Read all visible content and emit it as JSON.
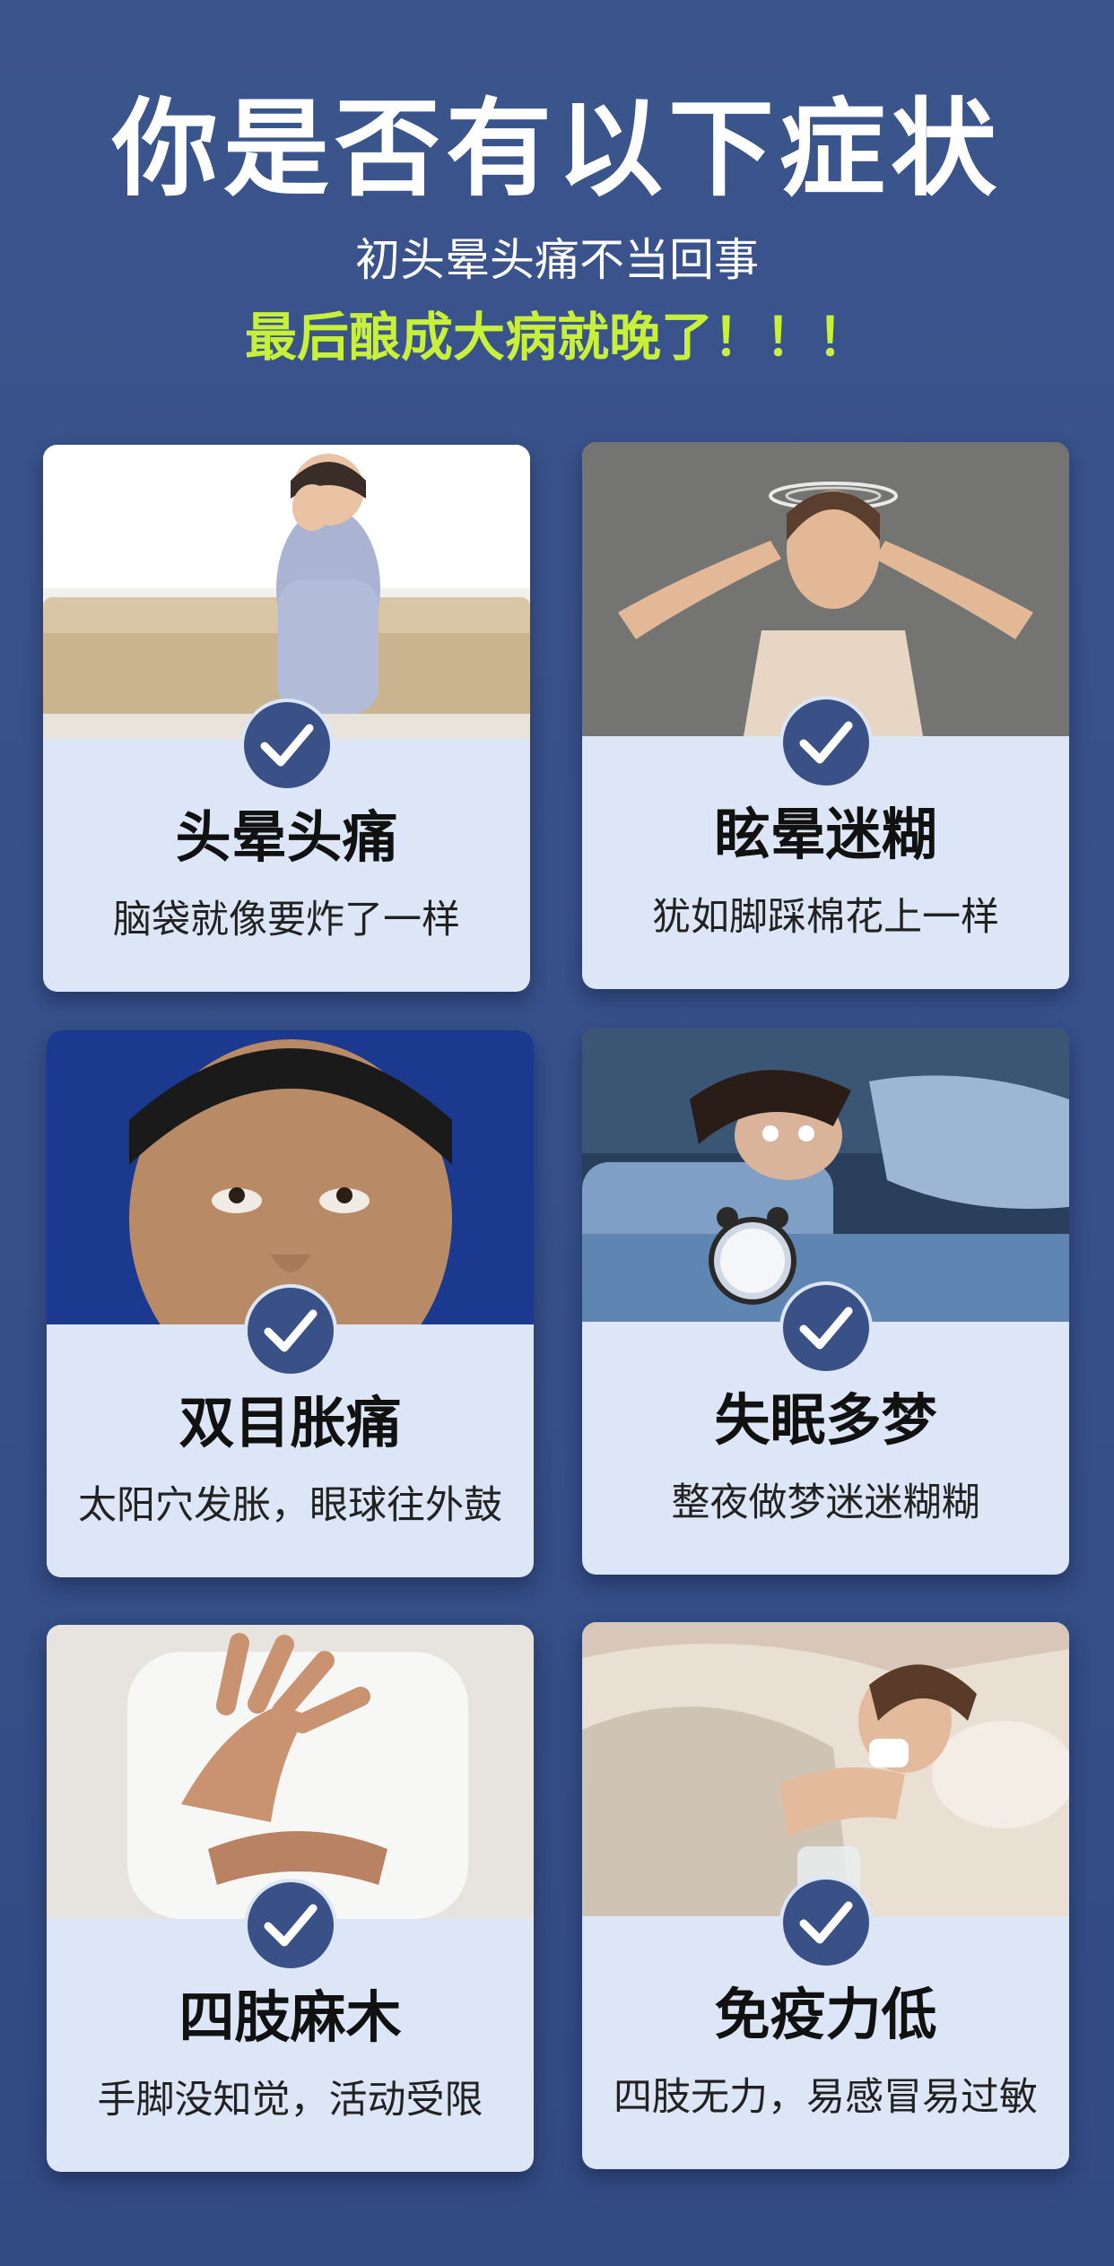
{
  "header": {
    "title": "你是否有以下症状",
    "subtitle": "初头晕头痛不当回事",
    "warning": "最后酿成大病就晚了！！！"
  },
  "colors": {
    "background": "#3a5188",
    "card": "#dde6f6",
    "accent_green": "#c8f03a",
    "badge": "#3a5188"
  },
  "symptoms": [
    {
      "title": "头晕头痛",
      "description": "脑袋就像要炸了一样",
      "icon": "check-icon"
    },
    {
      "title": "眩晕迷糊",
      "description": "犹如脚踩棉花上一样",
      "icon": "check-icon"
    },
    {
      "title": "双目胀痛",
      "description": "太阳穴发胀，眼球往外鼓",
      "icon": "check-icon"
    },
    {
      "title": "失眠多梦",
      "description": "整夜做梦迷迷糊糊",
      "icon": "check-icon"
    },
    {
      "title": "四肢麻木",
      "description": "手脚没知觉，活动受限",
      "icon": "check-icon"
    },
    {
      "title": "免疫力低",
      "description": "四肢无力，易感冒易过敏",
      "icon": "check-icon"
    }
  ]
}
